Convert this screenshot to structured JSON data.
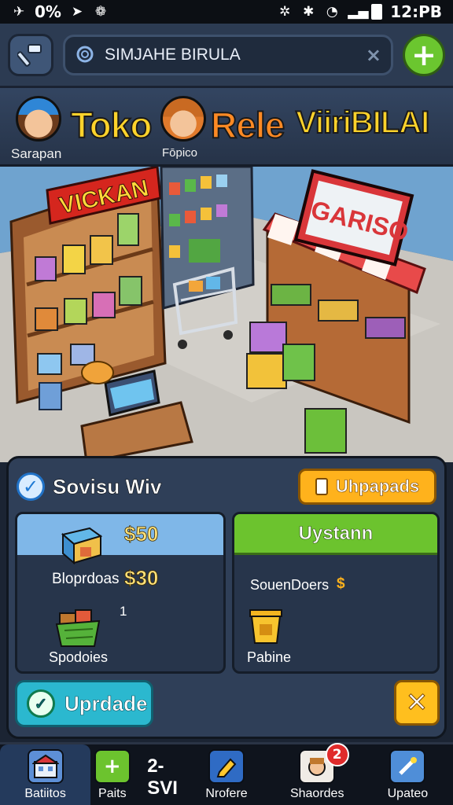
{
  "status_bar": {
    "left_text": "0%",
    "time": "12:PB"
  },
  "search": {
    "value": "SIMJAHE BIRULA",
    "placeholder": ""
  },
  "banner": {
    "title_parts": [
      "Toko",
      "Rele",
      "ViiriBILAI"
    ],
    "avatars": [
      {
        "label": "Sarapan"
      },
      {
        "label": "Fōpico"
      }
    ]
  },
  "scene": {
    "sign_left": "VICKAN",
    "sign_right": "GARISO"
  },
  "panel": {
    "title": "Sovisu Wiv",
    "updates_label": "Uhpapads",
    "left_card": {
      "price_top": "$50",
      "item_1": "Bloprdoas",
      "price_1": "$30",
      "count": "1",
      "item_2": "Spodoies"
    },
    "right_card": {
      "button_label": "Uystann",
      "item_1": "SouenDoers",
      "currency": "$",
      "item_2": "Pabine"
    },
    "update_button_label": "Uprdade"
  },
  "bottom_nav": {
    "items": [
      {
        "label": "Batiitos",
        "icon": "shop-icon"
      },
      {
        "label": "Paits",
        "extra": "2-SVI",
        "icon": "plus-icon"
      },
      {
        "label": "Nrofere",
        "icon": "pencil-icon"
      },
      {
        "label": "Shaordes",
        "badge": "2",
        "icon": "character-icon"
      },
      {
        "label": "Upateo",
        "icon": "wand-icon"
      }
    ]
  },
  "colors": {
    "accent_green": "#6cc32e",
    "accent_yellow": "#ffb21c",
    "accent_cyan": "#2bb8cf",
    "panel_bg": "#2f3f58"
  }
}
